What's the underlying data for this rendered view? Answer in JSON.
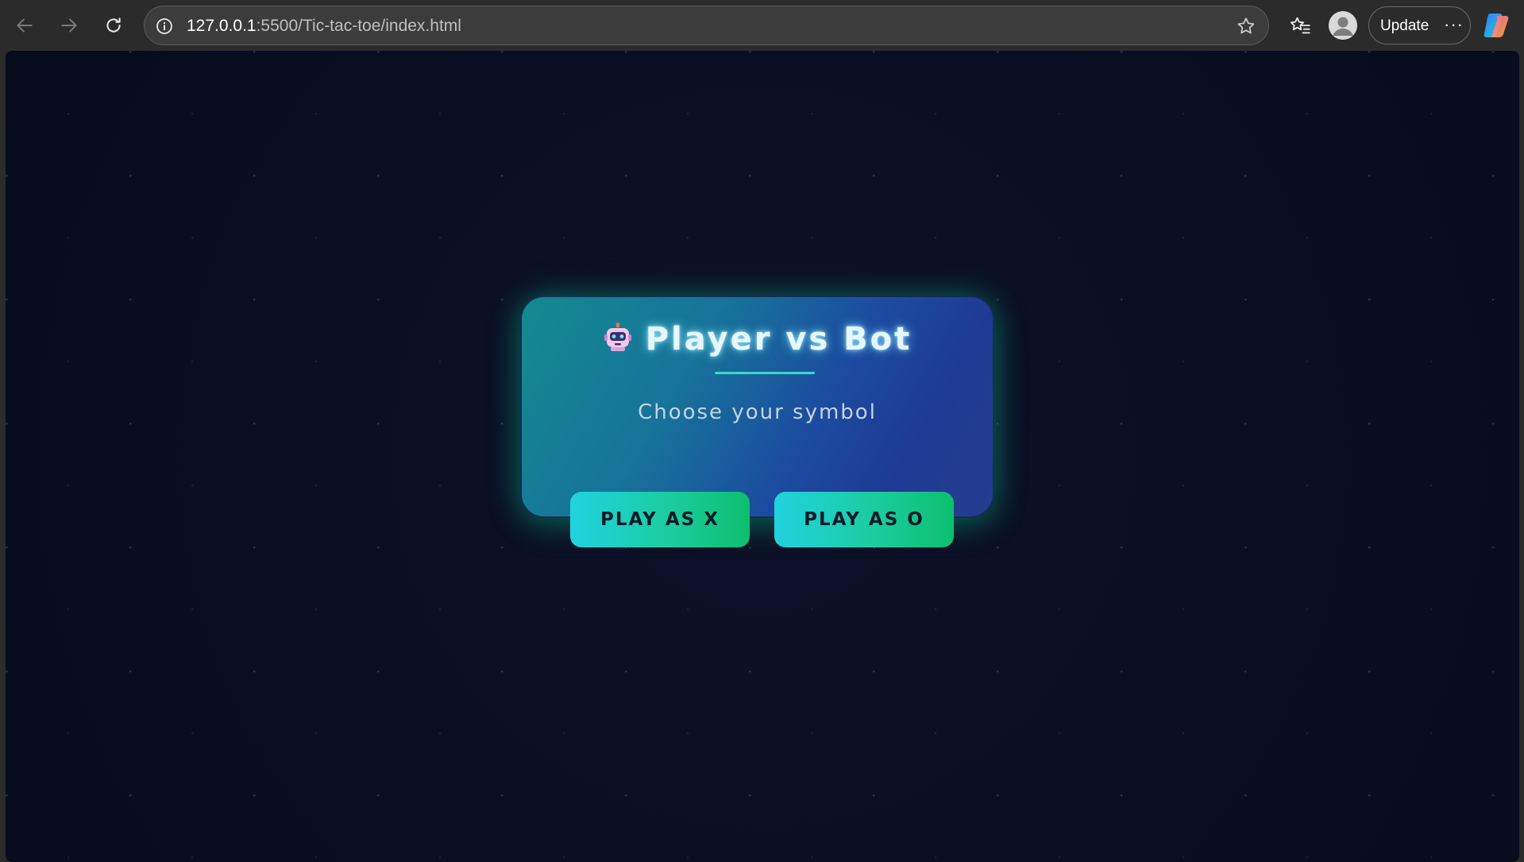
{
  "browser": {
    "url_host": "127.0.0.1",
    "url_rest": ":5500/Tic-tac-toe/index.html",
    "update_label": "Update",
    "more_label": "···"
  },
  "page": {
    "title": "Player vs Bot",
    "subtitle": "Choose your symbol",
    "buttons": {
      "play_x": "PLAY AS X",
      "play_o": "PLAY AS O"
    }
  },
  "colors": {
    "background": "#0a0e24",
    "card_start": "#138a8f",
    "card_end": "#233e8e",
    "button_start": "#20d3df",
    "button_end": "#0cbf6e",
    "accent_line": "#3fd6c4"
  }
}
